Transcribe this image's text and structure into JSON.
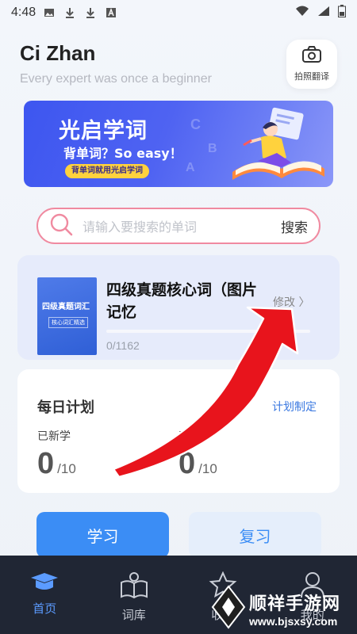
{
  "status_bar": {
    "time": "4:48",
    "icons": [
      "image-icon",
      "download-icon",
      "download-icon",
      "a-icon"
    ],
    "right_icons": [
      "wifi-icon",
      "signal-icon",
      "battery-icon"
    ]
  },
  "header": {
    "title": "Ci Zhan",
    "subtitle": "Every expert was once a beginner",
    "camera_button_label": "拍照翻译"
  },
  "banner": {
    "title": "光启学词",
    "subtitle": "背单词？So easy！",
    "tag": "背单词就用光启学词"
  },
  "search": {
    "placeholder": "请输入要搜索的单词",
    "button_label": "搜索"
  },
  "book": {
    "cover_title": "四级真题词汇",
    "cover_subtitle": "核心词汇精选",
    "title": "四级真题核心词（图片记忆",
    "edit_label": "修改 〉",
    "progress_text": "0/1162",
    "progress_fraction": 0
  },
  "plan": {
    "title": "每日计划",
    "set_label": "计划制定",
    "new_label": "已新学",
    "new_value": "0",
    "new_total": "/10",
    "second_label": "已",
    "second_value": "0",
    "second_total": "/10"
  },
  "actions": {
    "study_label": "学习",
    "review_label": "复习"
  },
  "nav": {
    "items": [
      {
        "label": "首页",
        "icon": "graduation-cap-icon",
        "active": true
      },
      {
        "label": "词库",
        "icon": "book-icon",
        "active": false
      },
      {
        "label": "收藏",
        "icon": "star-icon",
        "active": false
      },
      {
        "label": "我的",
        "icon": "person-icon",
        "active": false
      }
    ]
  },
  "watermark": {
    "text": "顺祥手游网",
    "url": "www.bjsxsy.com"
  },
  "colors": {
    "accent": "#3b8df5",
    "nav_bg": "#202634",
    "search_border": "#f08aa0",
    "banner": "#4f63f2",
    "arrow": "#e8141c"
  }
}
